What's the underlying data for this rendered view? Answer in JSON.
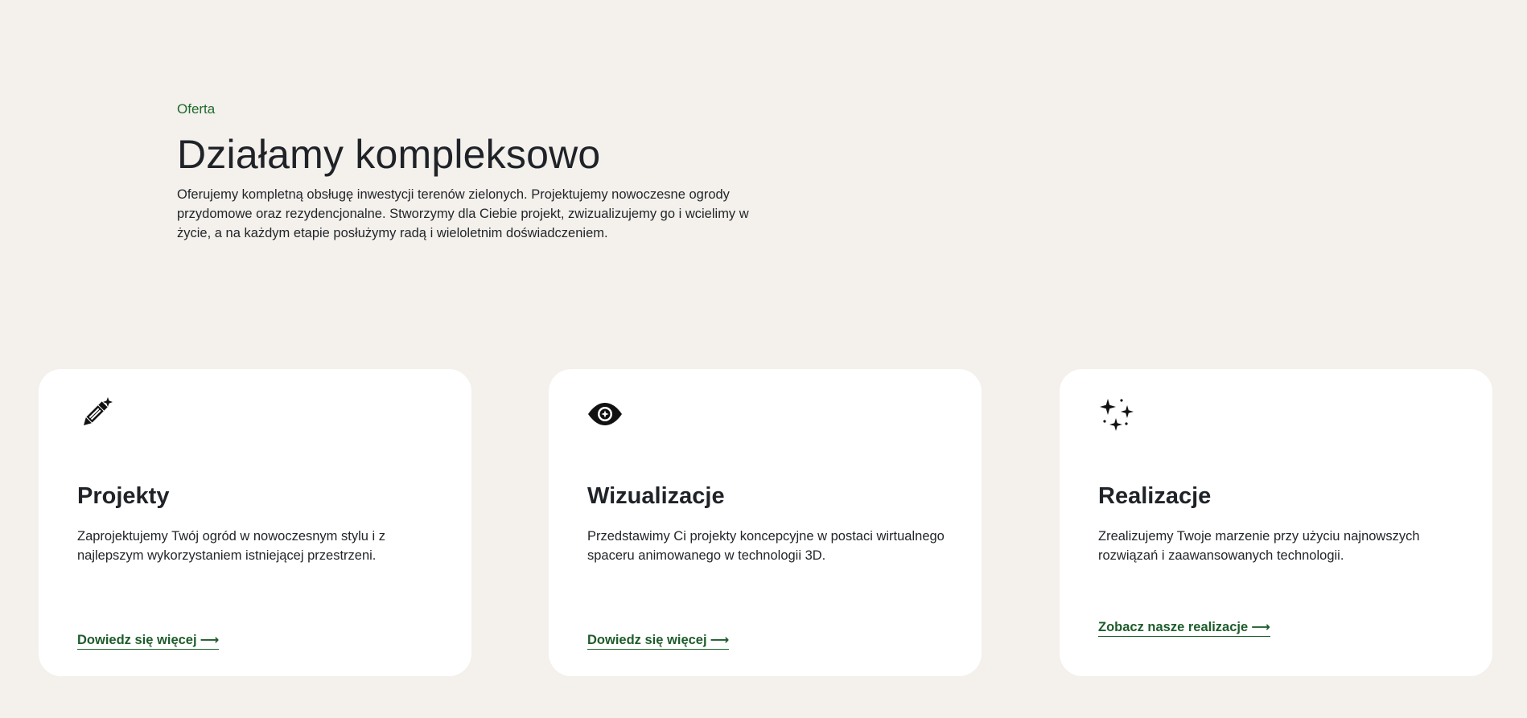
{
  "intro": {
    "eyebrow": "Oferta",
    "title": "Działamy kompleksowo",
    "lead": "Oferujemy kompletną obsługę inwestycji terenów zielonych. Projektujemy nowoczesne ogrody przydomowe oraz rezydencjonalne. Stworzymy dla Ciebie projekt, zwizualizujemy go i wcielimy w życie, a na każdym etapie posłużymy radą i wieloletnim doświadczeniem."
  },
  "cards": [
    {
      "icon": "pencil-sparkle-icon",
      "title": "Projekty",
      "text": "Zaprojektujemy Twój ogród w nowoczesnym stylu i z najlepszym wykorzystaniem istniejącej przestrzeni.",
      "link": "Dowiedz się więcej",
      "arrow": "⟶"
    },
    {
      "icon": "eye-icon",
      "title": "Wizualizacje",
      "text": "Przedstawimy Ci projekty koncepcyjne w postaci wirtualnego spaceru animowanego w technologii 3D.",
      "link": "Dowiedz się więcej",
      "arrow": "⟶"
    },
    {
      "icon": "sparkles-icon",
      "title": "Realizacje",
      "text": "Zrealizujemy Twoje marzenie przy użyciu najnowszych rozwiązań i zaawansowanych technologii.",
      "link": "Zobacz nasze realizacje",
      "arrow": "⟶"
    }
  ],
  "colors": {
    "background": "#f4f0ec",
    "card": "#ffffff",
    "accent": "#1e5c2b",
    "text": "#1f2328"
  }
}
